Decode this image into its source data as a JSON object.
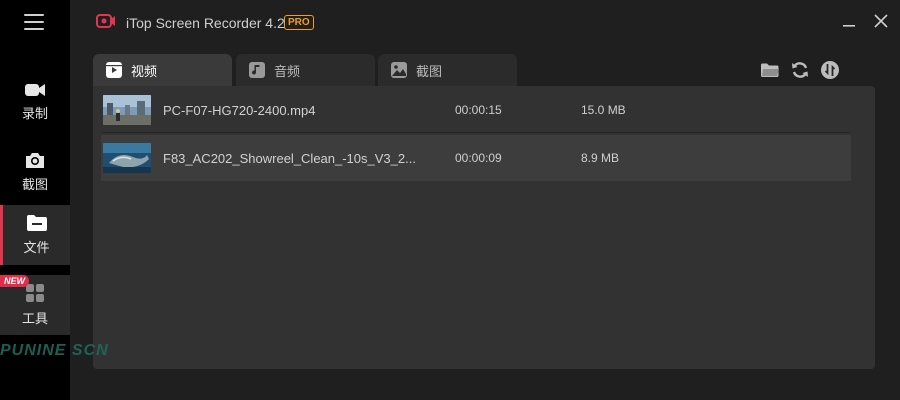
{
  "app": {
    "title": "iTop Screen Recorder 4.2",
    "pro": "PRO",
    "accent": "#e0364f",
    "pro_color": "#f0a020"
  },
  "sidebar": {
    "items": [
      {
        "label": "录制",
        "icon": "video-camera-icon"
      },
      {
        "label": "截图",
        "icon": "camera-icon"
      },
      {
        "label": "文件",
        "icon": "folder-icon",
        "active": true
      },
      {
        "label": "工具",
        "icon": "grid-icon",
        "badge": "NEW"
      }
    ]
  },
  "tabs": [
    {
      "label": "视频",
      "icon": "video-tab-icon",
      "active": true
    },
    {
      "label": "音频",
      "icon": "music-note-icon"
    },
    {
      "label": "截图",
      "icon": "image-icon"
    }
  ],
  "toolbar": {
    "icons": [
      "open-folder-icon",
      "refresh-icon",
      "compress-icon"
    ]
  },
  "files": [
    {
      "name": "PC-F07-HG720-2400.mp4",
      "duration": "00:00:15",
      "size": "15.0 MB"
    },
    {
      "name": "F83_AC202_Showreel_Clean_-10s_V3_2...",
      "duration": "00:00:09",
      "size": "8.9 MB",
      "selected": true
    }
  ],
  "watermark": "PUNINE SCN"
}
